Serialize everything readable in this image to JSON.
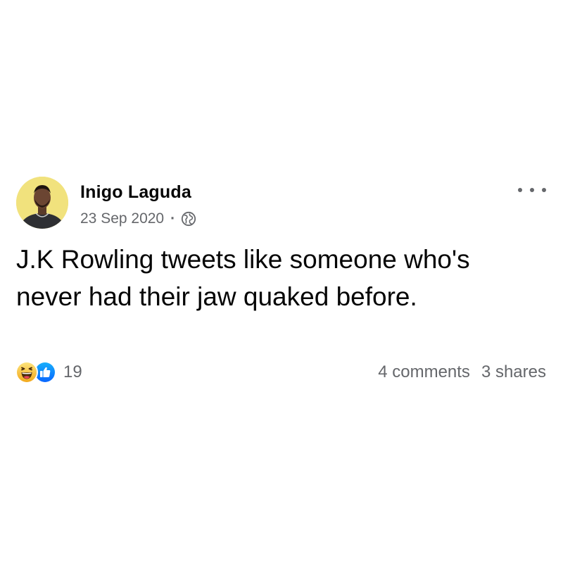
{
  "post": {
    "author": "Inigo Laguda",
    "date": "23 Sep 2020",
    "separator": "·",
    "privacy_icon": "globe-icon",
    "text": "J.K Rowling tweets like someone who's never had their jaw quaked before.",
    "reactions": {
      "icons": [
        "haha-icon",
        "like-icon"
      ],
      "count": "19"
    },
    "comments_label": "4 comments",
    "shares_label": "3 shares",
    "more_icon": "more-options-icon"
  },
  "colors": {
    "text_primary": "#050505",
    "text_secondary": "#65676b",
    "like_blue": "#1877f2",
    "haha_yellow": "#f7c12b",
    "avatar_background": "#f1e27d"
  }
}
